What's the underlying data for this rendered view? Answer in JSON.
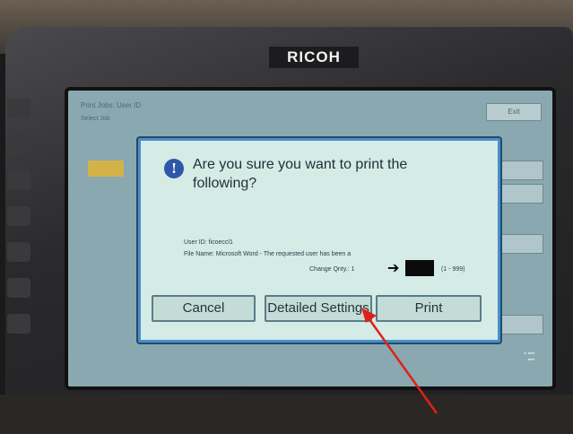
{
  "device": {
    "brand": "RICOH"
  },
  "background_screen": {
    "title": "Print Jobs: User ID",
    "subtitle": "Select Job",
    "exit_label": "Exit"
  },
  "dialog": {
    "message": "Are you sure you want to print the following?",
    "user_id_line": "User ID: ficoeccl1",
    "file_name_line": "File Name: Microsoft Word - The requested user has been a",
    "copies_label": "Change Qnty.: 1",
    "copies_range": "(1 - 999)",
    "buttons": {
      "cancel": "Cancel",
      "detailed_settings": "Detailed Settings",
      "print": "Print"
    }
  },
  "annotation": {
    "arrow_color": "#e0201a",
    "points_to": "detailed-settings-button"
  },
  "colors": {
    "dialog_bg": "#d4ebe6",
    "dialog_border": "#4b8fc7",
    "info_icon": "#2f57a8"
  }
}
